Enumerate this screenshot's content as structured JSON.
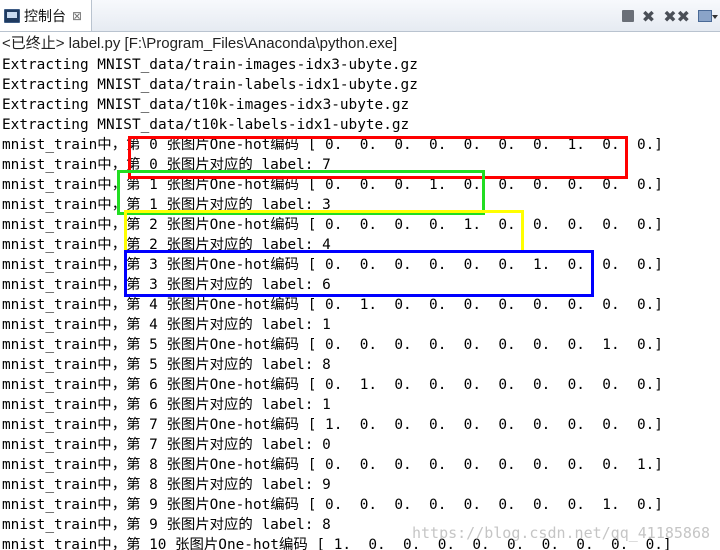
{
  "tab": {
    "title": "控制台",
    "close_glyph": "⊠",
    "icon": "console-icon"
  },
  "toolbar": {
    "terminate_icon": "terminate-icon",
    "remove_glyph": "✖",
    "remove_all_glyph": "✖✖",
    "options_icon": "display-selected-console-icon"
  },
  "status_text": "<已终止> label.py [F:\\Program_Files\\Anaconda\\python.exe]",
  "console_lines": [
    "Extracting MNIST_data/train-images-idx3-ubyte.gz",
    "Extracting MNIST_data/train-labels-idx1-ubyte.gz",
    "Extracting MNIST_data/t10k-images-idx3-ubyte.gz",
    "Extracting MNIST_data/t10k-labels-idx1-ubyte.gz",
    "mnist_train中，第 0 张图片One-hot编码 [ 0.  0.  0.  0.  0.  0.  0.  1.  0.  0.]",
    "mnist_train中，第 0 张图片对应的 label: 7",
    "mnist_train中，第 1 张图片One-hot编码 [ 0.  0.  0.  1.  0.  0.  0.  0.  0.  0.]",
    "mnist_train中，第 1 张图片对应的 label: 3",
    "mnist_train中，第 2 张图片One-hot编码 [ 0.  0.  0.  0.  1.  0.  0.  0.  0.  0.]",
    "mnist_train中，第 2 张图片对应的 label: 4",
    "mnist_train中，第 3 张图片One-hot编码 [ 0.  0.  0.  0.  0.  0.  1.  0.  0.  0.]",
    "mnist_train中，第 3 张图片对应的 label: 6",
    "mnist_train中，第 4 张图片One-hot编码 [ 0.  1.  0.  0.  0.  0.  0.  0.  0.  0.]",
    "mnist_train中，第 4 张图片对应的 label: 1",
    "mnist_train中，第 5 张图片One-hot编码 [ 0.  0.  0.  0.  0.  0.  0.  0.  1.  0.]",
    "mnist_train中，第 5 张图片对应的 label: 8",
    "mnist_train中，第 6 张图片One-hot编码 [ 0.  1.  0.  0.  0.  0.  0.  0.  0.  0.]",
    "mnist_train中，第 6 张图片对应的 label: 1",
    "mnist_train中，第 7 张图片One-hot编码 [ 1.  0.  0.  0.  0.  0.  0.  0.  0.  0.]",
    "mnist_train中，第 7 张图片对应的 label: 0",
    "mnist_train中，第 8 张图片One-hot编码 [ 0.  0.  0.  0.  0.  0.  0.  0.  0.  1.]",
    "mnist_train中，第 8 张图片对应的 label: 9",
    "mnist_train中，第 9 张图片One-hot编码 [ 0.  0.  0.  0.  0.  0.  0.  0.  1.  0.]",
    "mnist_train中，第 9 张图片对应的 label: 8",
    "mnist_train中，第 10 张图片One-hot编码 [ 1.  0.  0.  0.  0.  0.  0.  0.  0.  0.]"
  ],
  "highlight_colors": {
    "red": "#ff0000",
    "green": "#22dd22",
    "yellow": "#ffff00",
    "blue": "#0000ff"
  },
  "watermark": "https://blog.csdn.net/qq_41185868"
}
